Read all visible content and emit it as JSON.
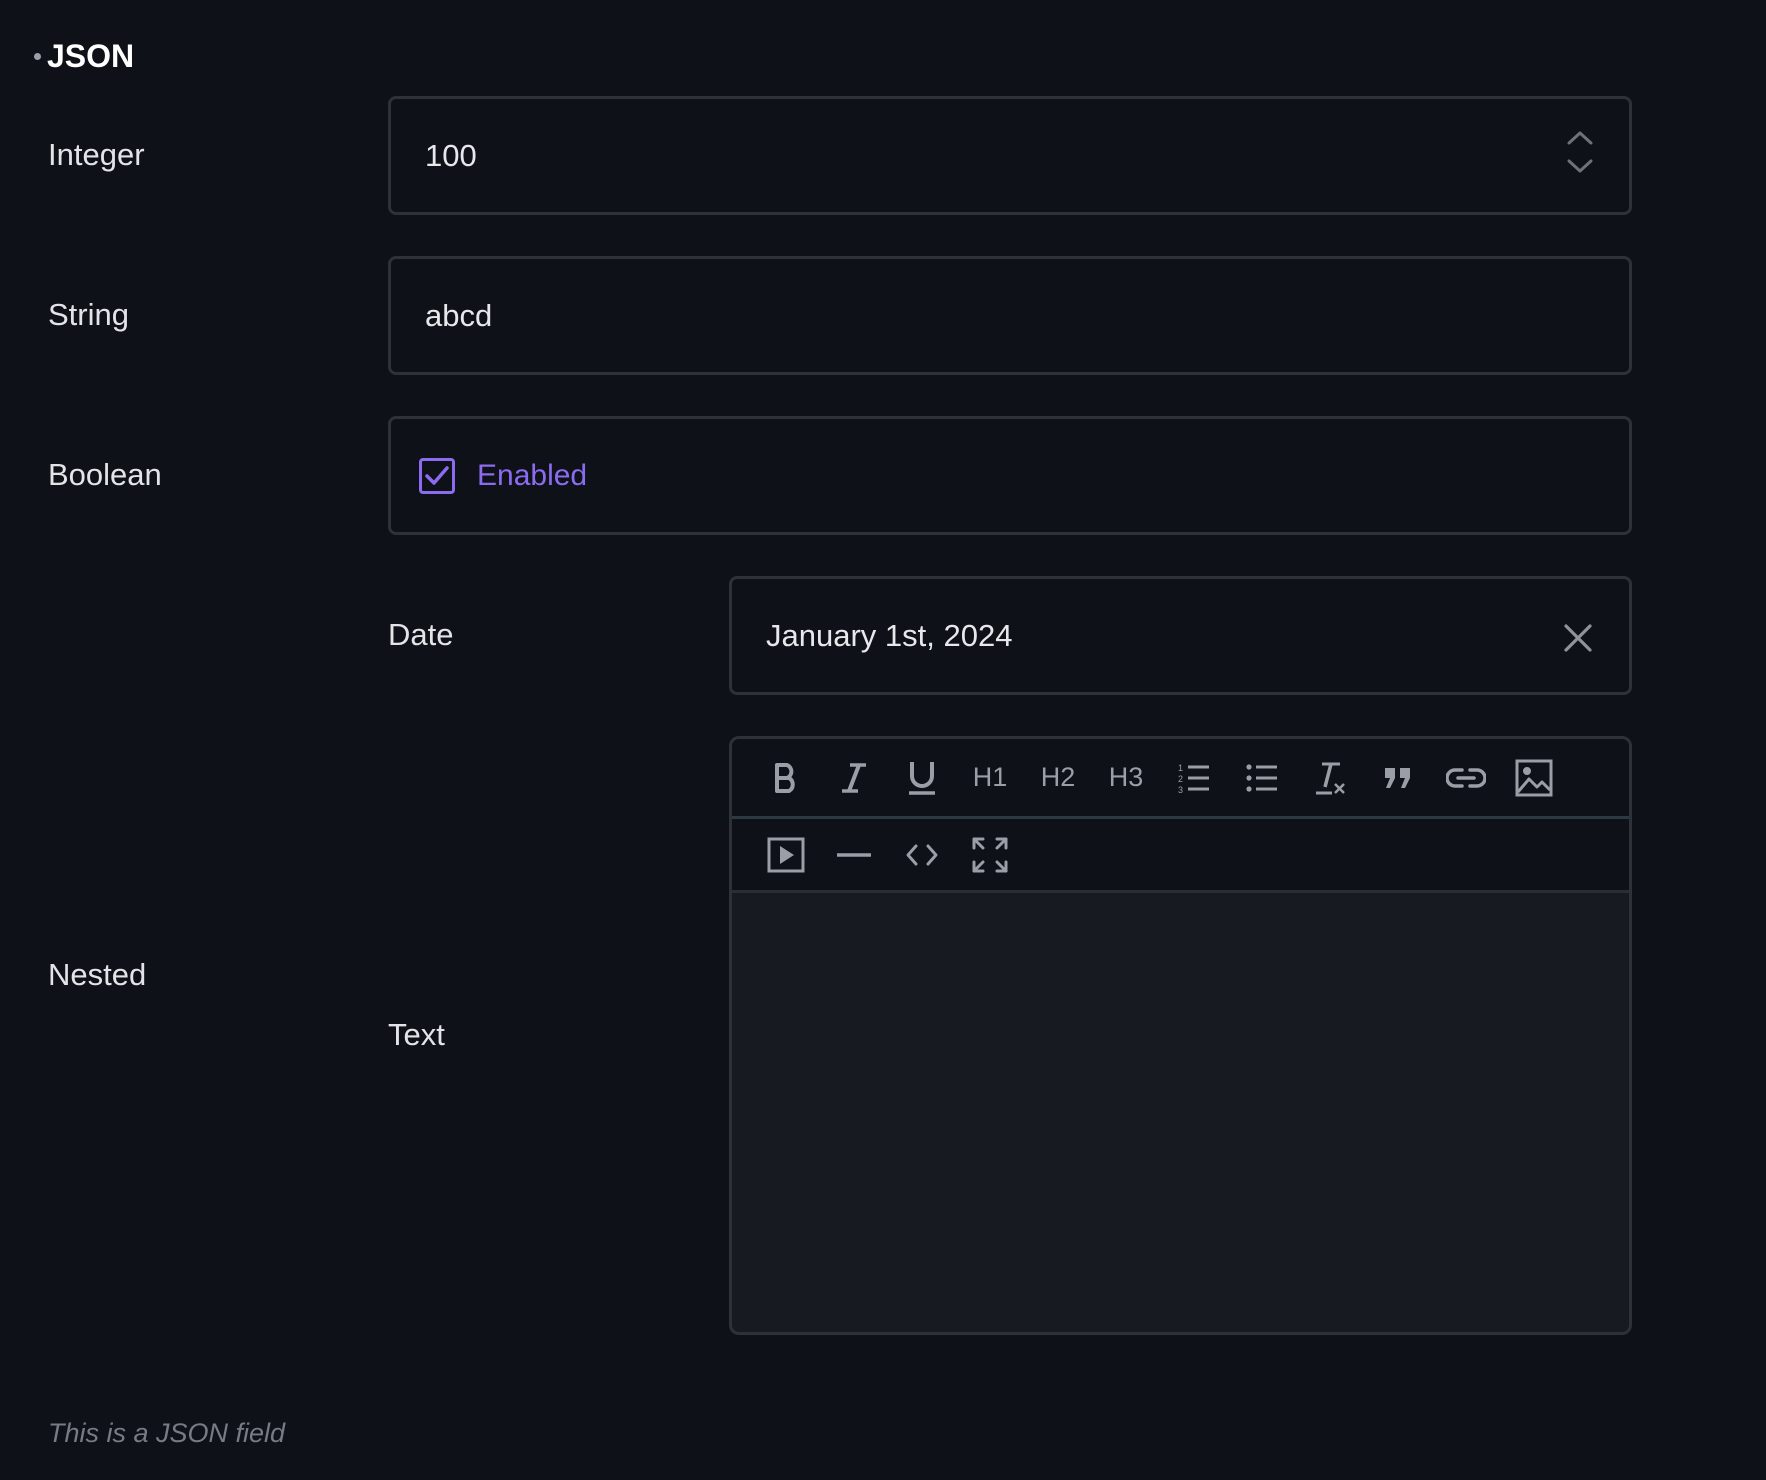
{
  "section": {
    "title": "JSON"
  },
  "fields": {
    "integer": {
      "label": "Integer",
      "value": "100"
    },
    "string": {
      "label": "String",
      "value": "abcd"
    },
    "boolean": {
      "label": "Boolean",
      "checked": true,
      "option_label": "Enabled"
    },
    "nested": {
      "label": "Nested",
      "date": {
        "label": "Date",
        "value": "January 1st, 2024"
      },
      "text": {
        "label": "Text",
        "toolbar": {
          "h1": "H1",
          "h2": "H2",
          "h3": "H3",
          "icons_row1": [
            "bold-icon",
            "italic-icon",
            "underline-icon",
            "h1",
            "h2",
            "h3",
            "ordered-list-icon",
            "bullet-list-icon",
            "clear-format-icon",
            "quote-icon",
            "link-icon",
            "image-icon"
          ],
          "icons_row2": [
            "video-icon",
            "horizontal-rule-icon",
            "code-icon",
            "fullscreen-icon"
          ]
        }
      }
    }
  },
  "help_text": "This is a JSON field",
  "colors": {
    "accent": "#8b6cf0",
    "background": "#0e1117",
    "border": "#2e3238"
  }
}
